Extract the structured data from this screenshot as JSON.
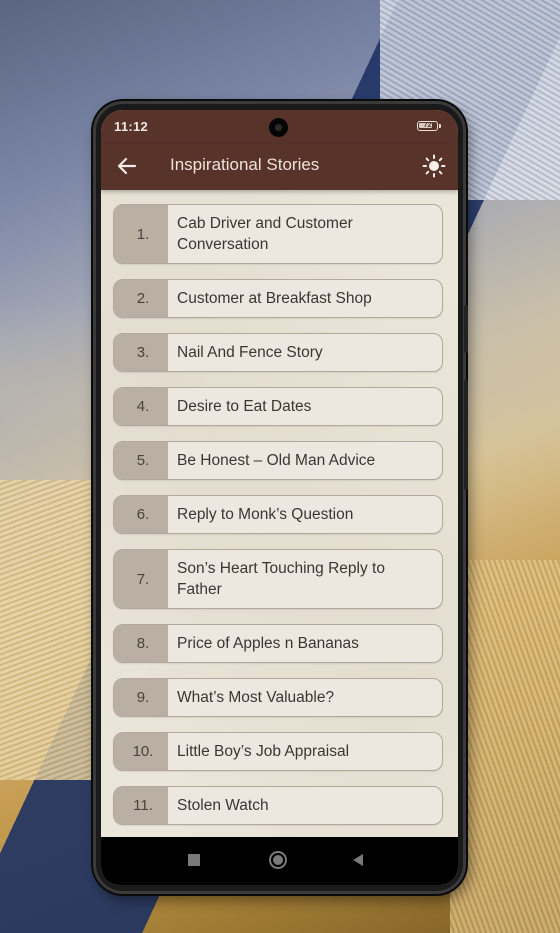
{
  "status_bar": {
    "time": "11:12",
    "battery_level": "72"
  },
  "app_bar": {
    "title": "Inspirational Stories",
    "back_icon": "arrow-left-icon",
    "theme_icon": "sun-icon"
  },
  "stories": [
    {
      "number": "1.",
      "title": "Cab Driver and Customer Conversation"
    },
    {
      "number": "2.",
      "title": "Customer at Breakfast Shop"
    },
    {
      "number": "3.",
      "title": "Nail And Fence Story"
    },
    {
      "number": "4.",
      "title": "Desire to Eat Dates"
    },
    {
      "number": "5.",
      "title": "Be Honest – Old Man Advice"
    },
    {
      "number": "6.",
      "title": "Reply to Monk’s Question"
    },
    {
      "number": "7.",
      "title": "Son’s Heart Touching Reply to Father"
    },
    {
      "number": "8.",
      "title": "Price of Apples n Bananas"
    },
    {
      "number": "9.",
      "title": "What’s Most Valuable?"
    },
    {
      "number": "10.",
      "title": "Little Boy’s Job Appraisal"
    },
    {
      "number": "11.",
      "title": "Stolen Watch"
    }
  ],
  "nav_bar": {
    "recent_icon": "square-icon",
    "home_icon": "circle-icon",
    "back_icon": "triangle-back-icon"
  },
  "colors": {
    "app_bar": "#57332a",
    "list_background": "#ebe6da",
    "number_cell": "#baafa3",
    "text": "#3b3633"
  }
}
